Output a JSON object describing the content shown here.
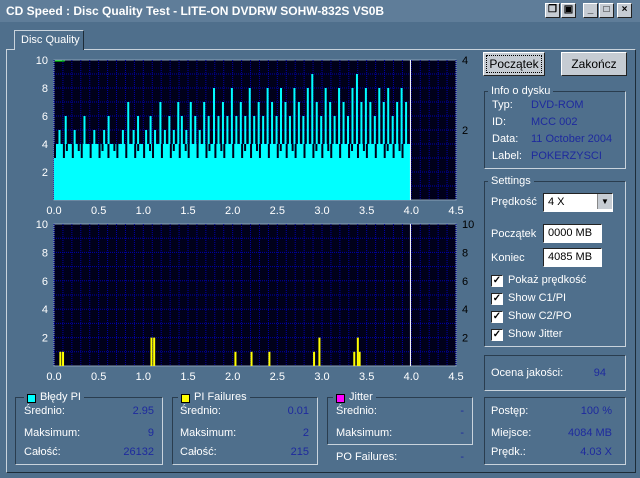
{
  "window": {
    "title": "CD Speed : Disc Quality Test - LITE-ON DVDRW SOHW-832S  VS0B",
    "icons": [
      "copy-icon",
      "save-icon",
      "minimize-icon",
      "maximize-icon",
      "close-icon"
    ]
  },
  "tabs": [
    {
      "label": "Disc Quality"
    }
  ],
  "buttons": {
    "start": "Początek",
    "end": "Zakończ"
  },
  "disc_info": {
    "title": "Info o dysku",
    "rows": [
      {
        "label": "Typ:",
        "value": "DVD-ROM"
      },
      {
        "label": "ID:",
        "value": "MCC 002"
      },
      {
        "label": "Data:",
        "value": "11 October 2004"
      },
      {
        "label": "Label:",
        "value": "POKERZYSCI"
      }
    ]
  },
  "settings": {
    "title": "Settings",
    "speed_label": "Prędkość",
    "speed_value": "4 X",
    "start_label": "Początek",
    "start_value": "0000 MB",
    "end_label": "Koniec",
    "end_value": "4085 MB",
    "checkboxes": [
      {
        "label": "Pokaż prędkość",
        "checked": true
      },
      {
        "label": "Show C1/PI",
        "checked": true
      },
      {
        "label": "Show C2/PO",
        "checked": true
      },
      {
        "label": "Show Jitter",
        "checked": true
      }
    ]
  },
  "quality": {
    "label": "Ocena jakości:",
    "value": "94"
  },
  "progress": {
    "rows": [
      {
        "label": "Postęp:",
        "value": "100 %"
      },
      {
        "label": "Miejsce:",
        "value": "4084 MB"
      },
      {
        "label": "Prędk.:",
        "value": "4.03 X"
      }
    ]
  },
  "stats": {
    "pi_errors": {
      "title": "Błędy PI",
      "color": "#00ffff",
      "rows": [
        {
          "label": "Średnio:",
          "value": "2.95"
        },
        {
          "label": "Maksimum:",
          "value": "9"
        },
        {
          "label": "Całość:",
          "value": "26132"
        }
      ]
    },
    "pi_failures": {
      "title": "PI Failures",
      "color": "#ffff00",
      "rows": [
        {
          "label": "Średnio:",
          "value": "0.01"
        },
        {
          "label": "Maksimum:",
          "value": "2"
        },
        {
          "label": "Całość:",
          "value": "215"
        }
      ]
    },
    "jitter": {
      "title": "Jitter",
      "color": "#ff00ff",
      "rows": [
        {
          "label": "Średnio:",
          "value": "-"
        },
        {
          "label": "Maksimum:",
          "value": "-"
        }
      ]
    },
    "po_failures": {
      "label": "PO Failures:",
      "value": "-"
    }
  },
  "chart_data": [
    {
      "type": "bar",
      "name": "PI errors",
      "color": "#00ffff",
      "xlim": [
        0,
        4.5
      ],
      "ylim": [
        0,
        10
      ],
      "x_ticks": [
        "0.0",
        "0.5",
        "1.0",
        "1.5",
        "2.0",
        "2.5",
        "3.0",
        "3.5",
        "4.0",
        "4.5"
      ],
      "y_ticks_left": [
        "2",
        "4",
        "6",
        "8",
        "10"
      ],
      "y_ticks_right": [
        "2",
        "4"
      ],
      "baseline_level": 4,
      "data_end_x": 3.99,
      "spikes": [
        {
          "x": 0.05,
          "y": 5
        },
        {
          "x": 0.08,
          "y": 3
        },
        {
          "x": 0.12,
          "y": 6
        },
        {
          "x": 0.17,
          "y": 4
        },
        {
          "x": 0.22,
          "y": 5
        },
        {
          "x": 0.28,
          "y": 3
        },
        {
          "x": 0.33,
          "y": 6
        },
        {
          "x": 0.38,
          "y": 4
        },
        {
          "x": 0.44,
          "y": 5
        },
        {
          "x": 0.5,
          "y": 3
        },
        {
          "x": 0.55,
          "y": 5
        },
        {
          "x": 0.6,
          "y": 6
        },
        {
          "x": 0.66,
          "y": 4
        },
        {
          "x": 0.7,
          "y": 3
        },
        {
          "x": 0.76,
          "y": 5
        },
        {
          "x": 0.82,
          "y": 7
        },
        {
          "x": 0.88,
          "y": 5
        },
        {
          "x": 0.93,
          "y": 6
        },
        {
          "x": 0.98,
          "y": 4
        },
        {
          "x": 1.02,
          "y": 5
        },
        {
          "x": 1.07,
          "y": 6
        },
        {
          "x": 1.12,
          "y": 5
        },
        {
          "x": 1.18,
          "y": 7
        },
        {
          "x": 1.23,
          "y": 5
        },
        {
          "x": 1.28,
          "y": 6
        },
        {
          "x": 1.33,
          "y": 5
        },
        {
          "x": 1.38,
          "y": 7
        },
        {
          "x": 1.42,
          "y": 6
        },
        {
          "x": 1.47,
          "y": 5
        },
        {
          "x": 1.52,
          "y": 7
        },
        {
          "x": 1.57,
          "y": 6
        },
        {
          "x": 1.62,
          "y": 5
        },
        {
          "x": 1.67,
          "y": 7
        },
        {
          "x": 1.72,
          "y": 6
        },
        {
          "x": 1.78,
          "y": 8
        },
        {
          "x": 1.83,
          "y": 6
        },
        {
          "x": 1.88,
          "y": 7
        },
        {
          "x": 1.93,
          "y": 6
        },
        {
          "x": 1.98,
          "y": 8
        },
        {
          "x": 2.03,
          "y": 6
        },
        {
          "x": 2.08,
          "y": 7
        },
        {
          "x": 2.13,
          "y": 6
        },
        {
          "x": 2.18,
          "y": 8
        },
        {
          "x": 2.23,
          "y": 6
        },
        {
          "x": 2.28,
          "y": 7
        },
        {
          "x": 2.33,
          "y": 6
        },
        {
          "x": 2.38,
          "y": 8
        },
        {
          "x": 2.43,
          "y": 7
        },
        {
          "x": 2.48,
          "y": 6
        },
        {
          "x": 2.53,
          "y": 8
        },
        {
          "x": 2.58,
          "y": 7
        },
        {
          "x": 2.63,
          "y": 6
        },
        {
          "x": 2.68,
          "y": 8
        },
        {
          "x": 2.73,
          "y": 7
        },
        {
          "x": 2.78,
          "y": 6
        },
        {
          "x": 2.83,
          "y": 8
        },
        {
          "x": 2.88,
          "y": 9
        },
        {
          "x": 2.93,
          "y": 7
        },
        {
          "x": 2.98,
          "y": 6
        },
        {
          "x": 3.03,
          "y": 8
        },
        {
          "x": 3.08,
          "y": 7
        },
        {
          "x": 3.13,
          "y": 6
        },
        {
          "x": 3.18,
          "y": 8
        },
        {
          "x": 3.23,
          "y": 7
        },
        {
          "x": 3.28,
          "y": 6
        },
        {
          "x": 3.33,
          "y": 8
        },
        {
          "x": 3.38,
          "y": 9
        },
        {
          "x": 3.43,
          "y": 7
        },
        {
          "x": 3.48,
          "y": 8
        },
        {
          "x": 3.53,
          "y": 7
        },
        {
          "x": 3.58,
          "y": 6
        },
        {
          "x": 3.63,
          "y": 8
        },
        {
          "x": 3.68,
          "y": 7
        },
        {
          "x": 3.73,
          "y": 8
        },
        {
          "x": 3.78,
          "y": 6
        },
        {
          "x": 3.83,
          "y": 7
        },
        {
          "x": 3.88,
          "y": 8
        },
        {
          "x": 3.93,
          "y": 7
        }
      ],
      "speed_line_level": 4
    },
    {
      "type": "bar",
      "name": "PI failures",
      "color": "#ffff00",
      "xlim": [
        0,
        4.5
      ],
      "ylim": [
        0,
        10
      ],
      "x_ticks": [
        "0.0",
        "0.5",
        "1.0",
        "1.5",
        "2.0",
        "2.5",
        "3.0",
        "3.5",
        "4.0",
        "4.5"
      ],
      "y_ticks_left": [
        "2",
        "4",
        "6",
        "8",
        "10"
      ],
      "y_ticks_right": [
        "2",
        "4",
        "6",
        "8",
        "10"
      ],
      "data_end_x": 3.99,
      "bars": [
        {
          "x": 0.06,
          "y": 1
        },
        {
          "x": 0.09,
          "y": 1
        },
        {
          "x": 1.08,
          "y": 2
        },
        {
          "x": 1.11,
          "y": 2
        },
        {
          "x": 2.02,
          "y": 1
        },
        {
          "x": 2.2,
          "y": 1
        },
        {
          "x": 2.4,
          "y": 1
        },
        {
          "x": 2.9,
          "y": 1
        },
        {
          "x": 2.96,
          "y": 2
        },
        {
          "x": 3.35,
          "y": 1
        },
        {
          "x": 3.39,
          "y": 2
        },
        {
          "x": 3.41,
          "y": 1
        }
      ]
    }
  ]
}
